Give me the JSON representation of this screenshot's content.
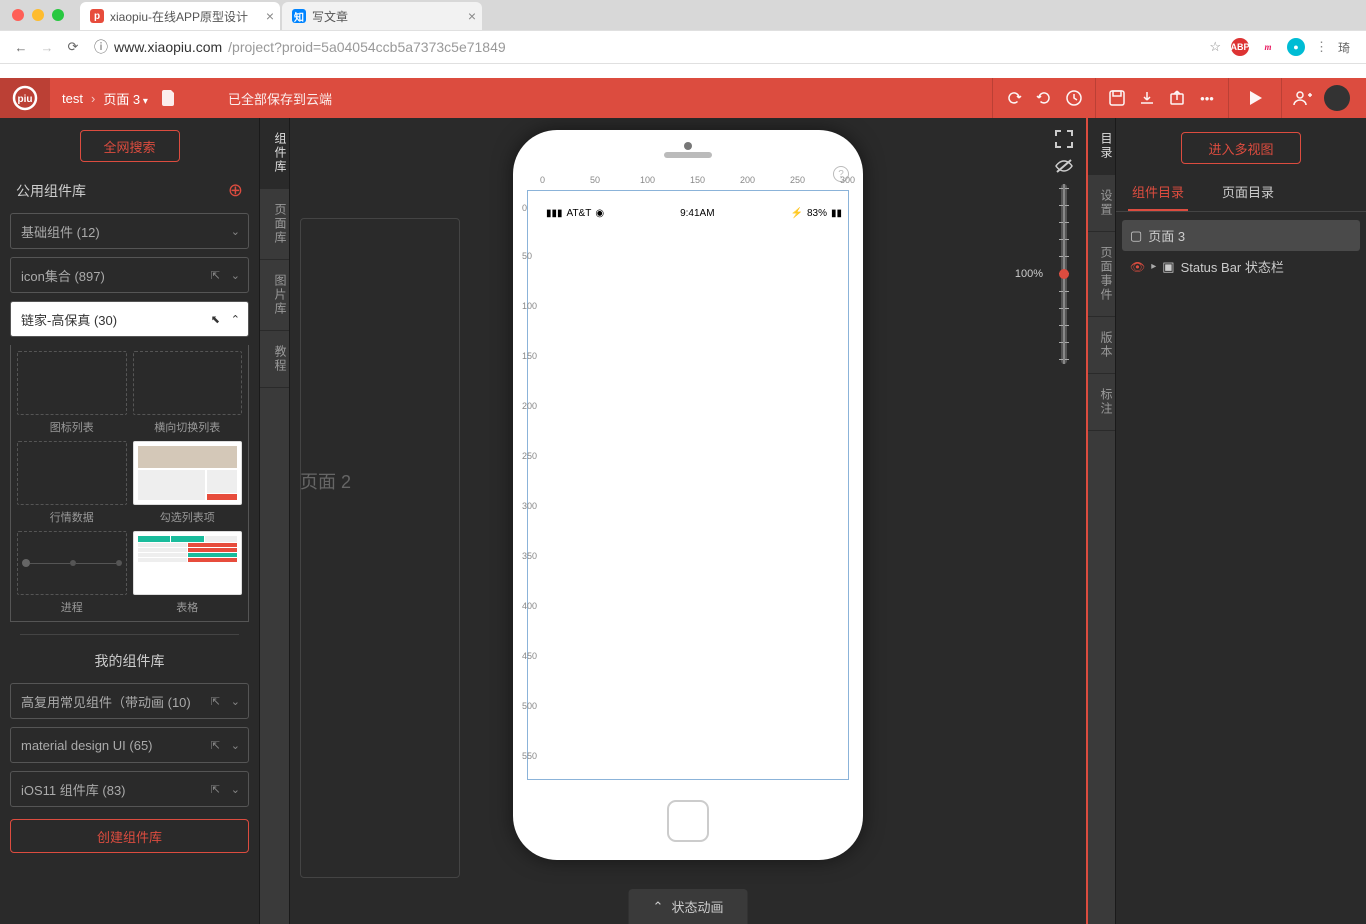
{
  "browser": {
    "tabs": [
      {
        "title": "xiaopiu-在线APP原型设计",
        "favicon": "piu"
      },
      {
        "title": "写文章",
        "favicon": "知"
      }
    ],
    "url_host": "www.xiaopiu.com",
    "url_path": "/project?proid=5a04054ccb5a7373c5e71849",
    "profile": "琦"
  },
  "app_bar": {
    "project": "test",
    "page": "页面 3",
    "save_status": "已全部保存到云端"
  },
  "left_panel": {
    "search_all": "全网搜索",
    "public_lib_title": "公用组件库",
    "selects": {
      "basic": "基础组件 (12)",
      "icons": "icon集合 (897)",
      "lianjia": "链家-高保真 (30)"
    },
    "components": [
      "图标列表",
      "横向切换列表",
      "行情数据",
      "勾选列表项",
      "进程",
      "表格"
    ],
    "my_lib_title": "我的组件库",
    "my_selects": {
      "anim": "高复用常见组件（带动画 (10)",
      "material": "material design UI (65)",
      "ios": "iOS11 组件库 (83)"
    },
    "create_lib": "创建组件库"
  },
  "side_tabs_left": [
    "组件库",
    "页面库",
    "图片库",
    "教程"
  ],
  "canvas": {
    "ghost_label": "页面 2",
    "zoom": "100%",
    "ruler_h": [
      "0",
      "50",
      "100",
      "150",
      "200",
      "250",
      "300"
    ],
    "ruler_v": [
      "0",
      "50",
      "100",
      "150",
      "200",
      "250",
      "300",
      "350",
      "400",
      "450",
      "500",
      "550"
    ],
    "status_bar": {
      "carrier": "AT&T",
      "time": "9:41AM",
      "battery": "83%"
    },
    "bottom_bar": "状态动画"
  },
  "side_tabs_right": [
    "目录",
    "设置",
    "页面事件",
    "版本",
    "标注"
  ],
  "right_panel": {
    "multi_view": "进入多视图",
    "tabs": [
      "组件目录",
      "页面目录"
    ],
    "tree": {
      "page": "页面 3",
      "status_bar": "Status Bar 状态栏"
    }
  }
}
